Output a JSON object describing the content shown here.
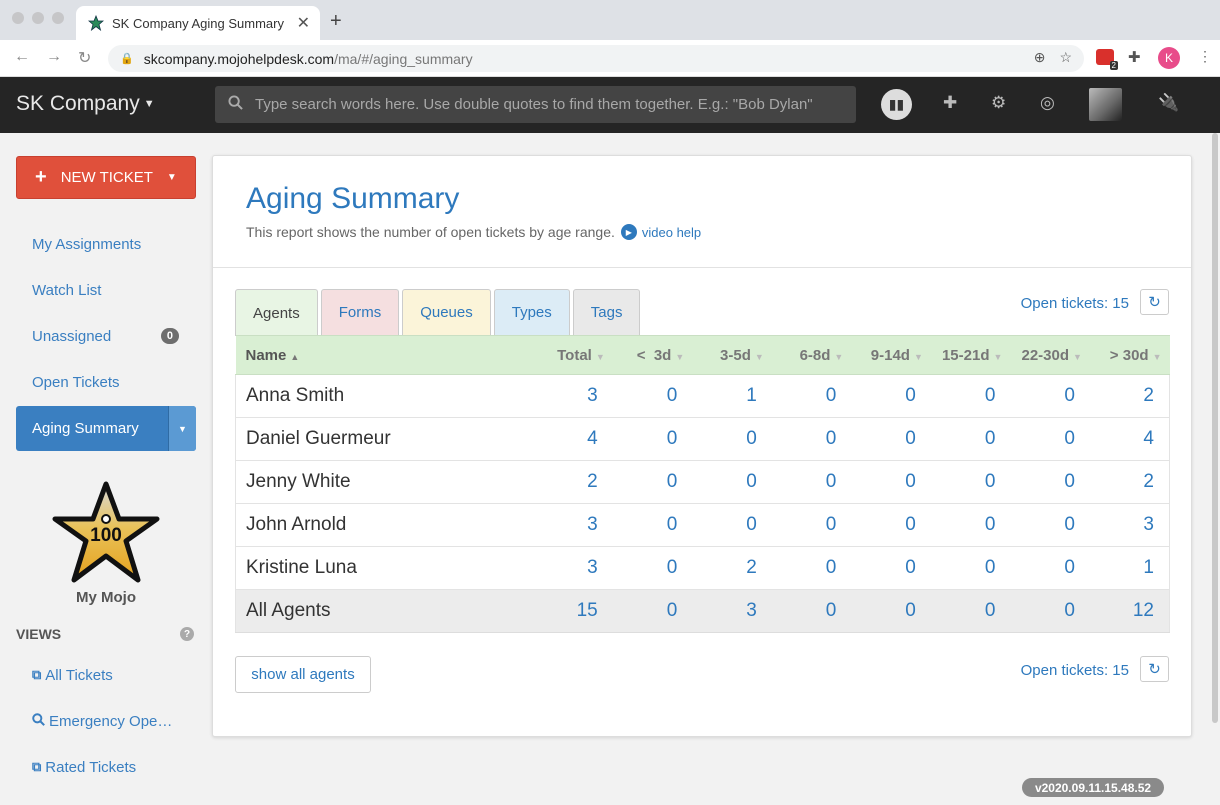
{
  "browser": {
    "tab_title": "SK Company Aging Summary",
    "url_host": "skcompany.mojohelpdesk.com",
    "url_path": "/ma/#/aging_summary",
    "ext_badge": "2",
    "profile_initial": "K"
  },
  "header": {
    "brand": "SK Company",
    "search_placeholder": "Type search words here. Use double quotes to find them together. E.g.: \"Bob Dylan\""
  },
  "sidebar": {
    "new_ticket_label": "NEW TICKET",
    "nav": [
      {
        "label": "My Assignments"
      },
      {
        "label": "Watch List"
      },
      {
        "label": "Unassigned",
        "count": "0"
      },
      {
        "label": "Open Tickets"
      },
      {
        "label": "Aging Summary"
      }
    ],
    "mojo_score": "100",
    "mojo_label": "My Mojo",
    "views_title": "VIEWS",
    "views": [
      {
        "label": "All Tickets"
      },
      {
        "label": "Emergency Ope…"
      },
      {
        "label": "Rated Tickets"
      }
    ]
  },
  "report": {
    "title": "Aging Summary",
    "subtitle": "This report shows the number of open tickets by age range.",
    "video_help": "video help",
    "tabs": [
      "Agents",
      "Forms",
      "Queues",
      "Types",
      "Tags"
    ],
    "open_tickets_label": "Open tickets: 15",
    "columns": [
      "Name",
      "Total",
      "<  3d",
      "3-5d",
      "6-8d",
      "9-14d",
      "15-21d",
      "22-30d",
      "> 30d"
    ],
    "rows": [
      [
        "Anna Smith",
        "3",
        "0",
        "1",
        "0",
        "0",
        "0",
        "0",
        "2"
      ],
      [
        "Daniel Guermeur",
        "4",
        "0",
        "0",
        "0",
        "0",
        "0",
        "0",
        "4"
      ],
      [
        "Jenny White",
        "2",
        "0",
        "0",
        "0",
        "0",
        "0",
        "0",
        "2"
      ],
      [
        "John Arnold",
        "3",
        "0",
        "0",
        "0",
        "0",
        "0",
        "0",
        "3"
      ],
      [
        "Kristine Luna",
        "3",
        "0",
        "2",
        "0",
        "0",
        "0",
        "0",
        "1"
      ]
    ],
    "total_row": [
      "All Agents",
      "15",
      "0",
      "3",
      "0",
      "0",
      "0",
      "0",
      "12"
    ],
    "show_all_label": "show all agents"
  },
  "footer": {
    "version": "v2020.09.11.15.48.52"
  },
  "colors": {
    "accent": "#2e79bd",
    "new_ticket": "#e0503b",
    "header_bg": "#252525",
    "table_header": "#d9efd3"
  }
}
